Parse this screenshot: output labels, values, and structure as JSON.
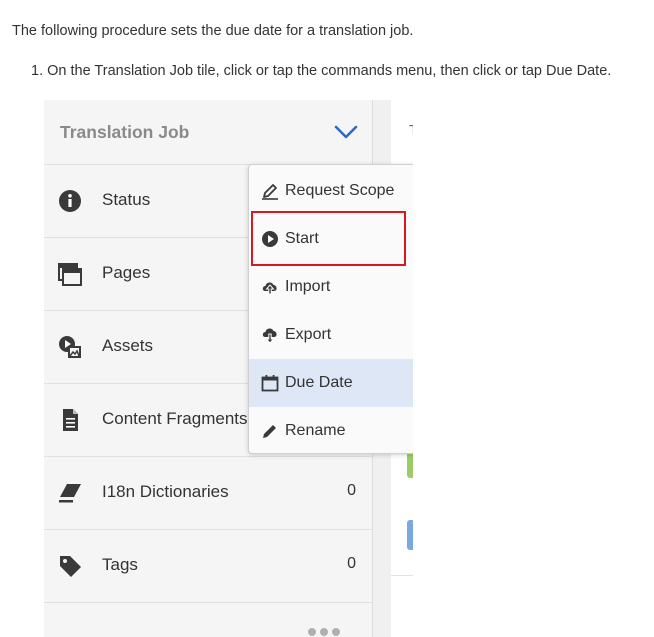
{
  "doc": {
    "intro": "The following procedure sets the due date for a translation job.",
    "step_number": "1.",
    "step_text": "On the Translation Job tile, click or tap the commands menu, then click or tap Due Date."
  },
  "tile": {
    "title": "Translation Job",
    "rows": [
      {
        "label": "Status",
        "icon": "info-icon",
        "count": ""
      },
      {
        "label": "Pages",
        "icon": "pages-icon",
        "count": ""
      },
      {
        "label": "Assets",
        "icon": "assets-icon",
        "count": ""
      },
      {
        "label": "Content Fragments",
        "icon": "document-icon",
        "count": ""
      },
      {
        "label": "I18n Dictionaries",
        "icon": "eraser-icon",
        "count": "0"
      },
      {
        "label": "Tags",
        "icon": "tag-icon",
        "count": "0"
      }
    ]
  },
  "side": {
    "tile_initial": "T"
  },
  "menu": {
    "items": [
      {
        "label": "Request Scope",
        "icon": "request-scope-icon"
      },
      {
        "label": "Start",
        "icon": "play-icon"
      },
      {
        "label": "Import",
        "icon": "cloud-upload-icon"
      },
      {
        "label": "Export",
        "icon": "cloud-download-icon"
      },
      {
        "label": "Due Date",
        "icon": "calendar-icon"
      },
      {
        "label": "Rename",
        "icon": "pencil-icon"
      }
    ],
    "selected": "Due Date",
    "highlighted": "Start"
  },
  "colors": {
    "accent": "#2c6bc9",
    "highlight_border": "#d7191f",
    "selected_bg": "#dee7f5"
  }
}
